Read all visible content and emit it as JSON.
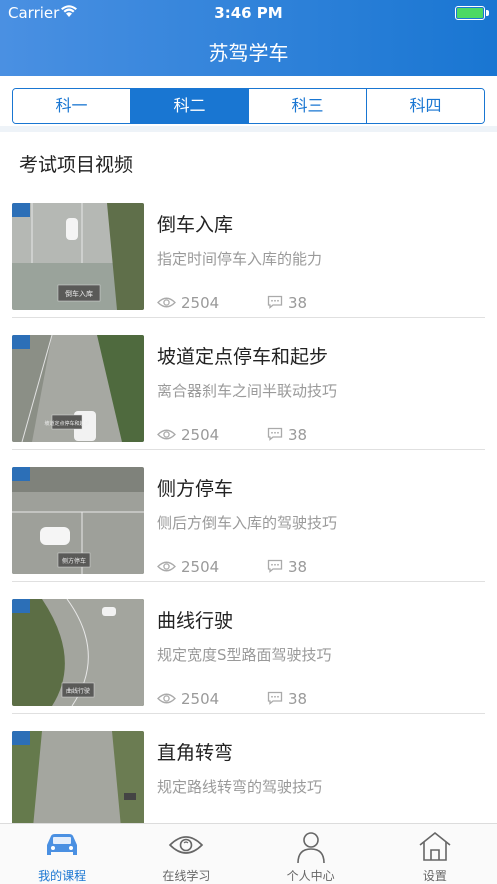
{
  "status_bar": {
    "carrier": "Carrier",
    "time": "3:46 PM"
  },
  "header": {
    "title": "苏驾学车"
  },
  "segments": [
    {
      "label": "科一",
      "active": false
    },
    {
      "label": "科二",
      "active": true
    },
    {
      "label": "科三",
      "active": false
    },
    {
      "label": "科四",
      "active": false
    }
  ],
  "section": {
    "title": "考试项目视频"
  },
  "videos": [
    {
      "title": "倒车入库",
      "desc": "指定时间停车入库的能力",
      "views": "2504",
      "comments": "38",
      "caption": "倒车入库"
    },
    {
      "title": "坡道定点停车和起步",
      "desc": "离合器刹车之间半联动技巧",
      "views": "2504",
      "comments": "38",
      "caption": "坡道定点停车和起步"
    },
    {
      "title": "侧方停车",
      "desc": "侧后方倒车入库的驾驶技巧",
      "views": "2504",
      "comments": "38",
      "caption": "侧方停车"
    },
    {
      "title": "曲线行驶",
      "desc": "规定宽度S型路面驾驶技巧",
      "views": "2504",
      "comments": "38",
      "caption": "曲线行驶"
    },
    {
      "title": "直角转弯",
      "desc": "规定路线转弯的驾驶技巧",
      "views": "",
      "comments": "",
      "caption": ""
    }
  ],
  "tabbar": [
    {
      "label": "我的课程",
      "icon": "car-icon",
      "active": true
    },
    {
      "label": "在线学习",
      "icon": "eye-icon",
      "active": false
    },
    {
      "label": "个人中心",
      "icon": "person-icon",
      "active": false
    },
    {
      "label": "设置",
      "icon": "house-icon",
      "active": false
    }
  ],
  "colors": {
    "primary": "#1976d2",
    "header_start": "#4a90e2",
    "muted": "#9a9a9a"
  }
}
